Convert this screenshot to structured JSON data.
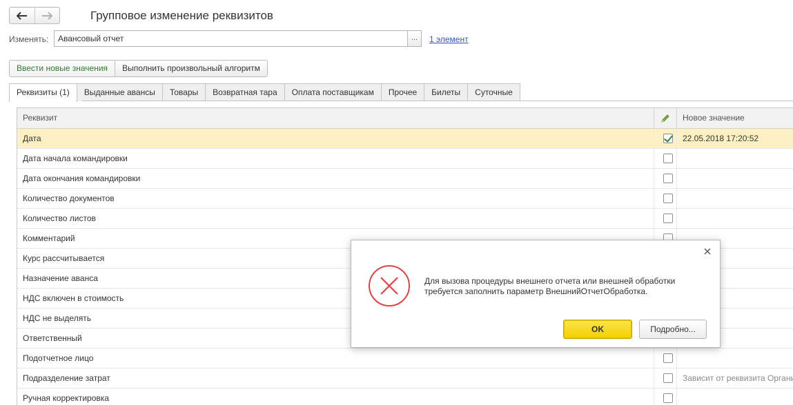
{
  "window": {
    "title": "Групповое изменение реквизитов",
    "nav_back_icon": "arrow-left-icon",
    "nav_forward_icon": "arrow-right-icon"
  },
  "change_field": {
    "label": "Изменять:",
    "value": "Авансовый отчет",
    "select_button": "...",
    "elements_link": "1 элемент"
  },
  "command_bar": {
    "enter_values": "Ввести новые значения",
    "run_algorithm": "Выполнить произвольный алгоритм"
  },
  "tabs": [
    {
      "label": "Реквизиты (1)"
    },
    {
      "label": "Выданные авансы"
    },
    {
      "label": "Товары"
    },
    {
      "label": "Возвратная тара"
    },
    {
      "label": "Оплата поставщикам"
    },
    {
      "label": "Прочее"
    },
    {
      "label": "Билеты"
    },
    {
      "label": "Суточные"
    }
  ],
  "grid": {
    "headers": {
      "attribute": "Реквизит",
      "edit_icon": "pencil-icon",
      "new_value": "Новое значение"
    },
    "rows": [
      {
        "name": "Дата",
        "checked": true,
        "value": "22.05.2018 17:20:52"
      },
      {
        "name": "Дата начала командировки",
        "checked": false,
        "value": ""
      },
      {
        "name": "Дата окончания командировки",
        "checked": false,
        "value": ""
      },
      {
        "name": "Количество документов",
        "checked": false,
        "value": ""
      },
      {
        "name": "Количество листов",
        "checked": false,
        "value": ""
      },
      {
        "name": "Комментарий",
        "checked": false,
        "value": ""
      },
      {
        "name": "Курс рассчитывается",
        "checked": false,
        "value": ""
      },
      {
        "name": "Назначение аванса",
        "checked": false,
        "value": ""
      },
      {
        "name": "НДС включен в стоимость",
        "checked": false,
        "value": ""
      },
      {
        "name": "НДС не выделять",
        "checked": false,
        "value": ""
      },
      {
        "name": "Ответственный",
        "checked": false,
        "value": ""
      },
      {
        "name": "Подотчетное лицо",
        "checked": false,
        "value": ""
      },
      {
        "name": "Подразделение затрат",
        "checked": false,
        "value": "Зависит от реквизита Организация"
      },
      {
        "name": "Ручная корректировка",
        "checked": false,
        "value": ""
      }
    ]
  },
  "dialog": {
    "icon": "error-x-icon",
    "close_icon": "close-icon",
    "message_line1": "Для вызова процедуры внешнего отчета или внешней обработки",
    "message_line2": "требуется заполнить параметр ВнешнийОтчетОбработка.",
    "ok_label": "OK",
    "details_label": "Подробно...",
    "colors": {
      "error": "#e84040",
      "ok_button": "#f4cf00"
    }
  }
}
